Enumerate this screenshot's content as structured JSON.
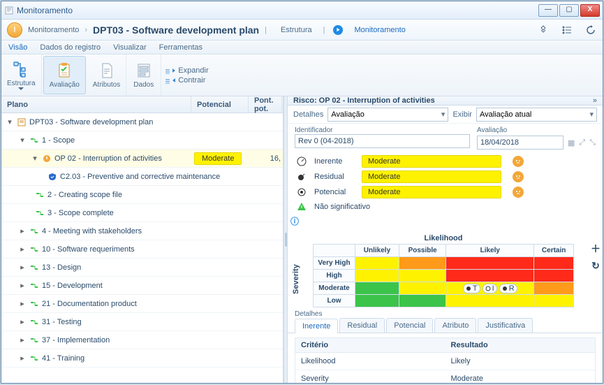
{
  "window": {
    "title": "Monitoramento"
  },
  "breadcrumb": {
    "root": "Monitoramento",
    "item": "DPT03 - Software development plan",
    "tabs": {
      "estrutura": "Estrutura",
      "monitoramento": "Monitoramento"
    }
  },
  "menu": {
    "visao": "Visão",
    "dados": "Dados do registro",
    "visualizar": "Visualizar",
    "ferramentas": "Ferramentas"
  },
  "toolbar": {
    "estrutura": "Estrutura",
    "avaliacao": "Avaliação",
    "atributos": "Atributos",
    "dados": "Dados",
    "expandir": "Expandir",
    "contrair": "Contrair"
  },
  "columns": {
    "plano": "Plano",
    "potencial": "Potencial",
    "pont": "Pont. pot."
  },
  "tree": {
    "root": "DPT03 - Software development plan",
    "n1": "1 - Scope",
    "n1a": "OP 02 - Interruption of activities",
    "n1a_pot": "Moderate",
    "n1a_pont": "16,",
    "n1a1": "C2.03 - Preventive and corrective maintenance",
    "n1b": "2 - Creating scope file",
    "n1c": "3 - Scope complete",
    "n4": "4 - Meeting with stakeholders",
    "n10": "10 - Software requeriments",
    "n13": "13 - Design",
    "n15": "15 - Development",
    "n21": "21 - Documentation product",
    "n31": "31 - Testing",
    "n37": "37 - Implementation",
    "n41": "41 - Training"
  },
  "panel": {
    "title": "Risco: OP 02 - Interruption of activities",
    "detalhes_lbl": "Detalhes",
    "avaliacao_sel": "Avaliação",
    "exibir_lbl": "Exibir",
    "exibir_sel": "Avaliação atual",
    "ident_lbl": "Identificador",
    "ident_val": "Rev 0 (04-2018)",
    "aval_lbl": "Avaliação",
    "aval_val": "18/04/2018",
    "inerente": "Inerente",
    "residual": "Residual",
    "potencial": "Potencial",
    "naosig": "Não significativo",
    "chip": "Moderate",
    "matrix": {
      "likelihood": "Likelihood",
      "severity": "Severity",
      "cols": [
        "Unlikely",
        "Possible",
        "Likely",
        "Certain"
      ],
      "rows": [
        "Very High",
        "High",
        "Moderate",
        "Low"
      ],
      "pills": [
        "T",
        "I",
        "R"
      ]
    },
    "tabs": {
      "inerente": "Inerente",
      "residual": "Residual",
      "potencial": "Potencial",
      "atributo": "Atributo",
      "justif": "Justificativa"
    },
    "table": {
      "criterio": "Critério",
      "resultado": "Resultado",
      "r1c": "Likelihood",
      "r1r": "Likely",
      "r2c": "Severity",
      "r2r": "Moderate"
    }
  }
}
